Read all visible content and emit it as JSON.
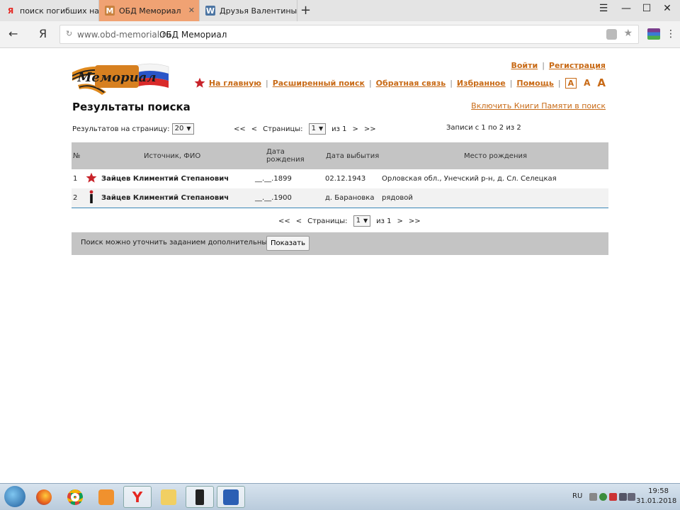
{
  "browser": {
    "tabs": [
      {
        "label": "поиск погибших на войне",
        "icon": "yandex-icon"
      },
      {
        "label": "ОБД Мемориал",
        "icon": "memorial-favicon",
        "active": true
      },
      {
        "label": "Друзья Валентины Скор – ",
        "icon": "vk-icon"
      }
    ],
    "new_tab": "+",
    "url_host": "www.obd-memorial.ru",
    "url_title": "ОБД Мемориал",
    "back": "←",
    "yandex": "Я"
  },
  "header": {
    "login": "Войти",
    "register": "Регистрация",
    "nav": [
      "На главную",
      "Расширенный поиск",
      "Обратная связь",
      "Избранное",
      "Помощь"
    ],
    "font_sizes": [
      "A",
      "A",
      "A"
    ],
    "page_title": "Результаты поиска",
    "books_link": "Включить Книги Памяти в поиск"
  },
  "controls": {
    "per_page_label": "Результатов на страницу:",
    "per_page_value": "20",
    "first": "<<",
    "prev": "<",
    "pages_label": "Страницы:",
    "page_value": "1",
    "of": "из 1",
    "next": ">",
    "last": ">>",
    "records": "Записи с 1 по 2 из 2"
  },
  "table": {
    "headers": [
      "№",
      "Источник, ФИО",
      "Дата рождения",
      "Дата выбытия",
      "Место рождения"
    ],
    "rows": [
      {
        "num": "1",
        "icon": "red-star-icon",
        "name": "Зайцев Климентий Степанович",
        "birth": "__.__.1899",
        "leave": "02.12.1943",
        "place": "Орловская обл., Унечский р-н, д. Сл. Селецкая"
      },
      {
        "num": "2",
        "icon": "soldier-icon",
        "name": "Зайцев Климентий Степанович",
        "birth": "__.__.1900",
        "leave": "д. Барановка",
        "place": "рядовой"
      }
    ]
  },
  "refine": {
    "text": "Поиск можно уточнить заданием дополнительных полей",
    "button": "Показать"
  },
  "taskbar": {
    "lang": "RU",
    "time": "19:58",
    "date": "31.01.2018"
  }
}
